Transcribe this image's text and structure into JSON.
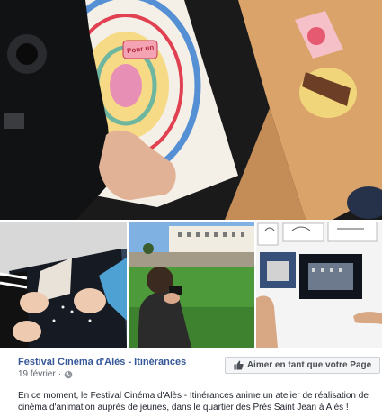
{
  "post": {
    "page_name": "Festival Cinéma d'Alès - Itinérances",
    "date": "19 février",
    "separator": "·",
    "audience_icon": "globe-icon",
    "like_icon": "thumbs-up-icon",
    "like_button_label": "Aimer en tant que votre Page",
    "text": "En ce moment, le Festival Cinéma d'Alès - Itinérances anime un atelier de réalisation de cinéma d'animation auprès de jeunes, dans le quartier des Prés Saint Jean à Alès !"
  },
  "photos": {
    "main_sign_text": "Pour un",
    "colors": {
      "accent_link": "#365899",
      "button_border": "#ccd0d5",
      "button_bg": "#f5f6f7"
    }
  }
}
